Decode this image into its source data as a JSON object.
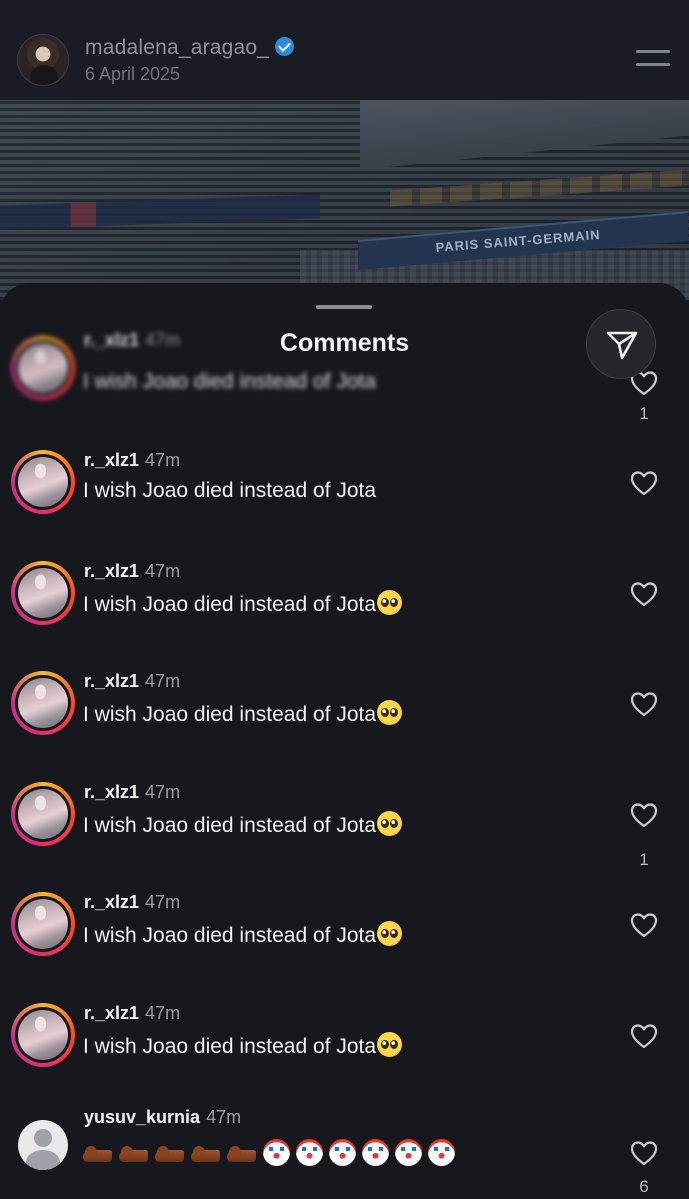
{
  "header": {
    "username": "madalena_aragao_",
    "date": "6 April 2025"
  },
  "photo": {
    "banner_text": "PARIS SAINT-GERMAIN"
  },
  "sheet": {
    "title": "Comments"
  },
  "comments": [
    {
      "user": "r._xlz1",
      "time": "47m",
      "text": "I wish Joao died instead of Jota",
      "likes": "1",
      "obscured": true
    },
    {
      "user": "r._xlz1",
      "time": "47m",
      "text": "I wish Joao died instead of Jota",
      "likes": ""
    },
    {
      "user": "r._xlz1",
      "time": "47m",
      "text": "I wish Joao died instead of Jota",
      "likes": "",
      "emoji": "pleading-face"
    },
    {
      "user": "r._xlz1",
      "time": "47m",
      "text": "I wish Joao died instead of Jota",
      "likes": "",
      "emoji": "pleading-face"
    },
    {
      "user": "r._xlz1",
      "time": "47m",
      "text": "I wish Joao died instead of Jota",
      "likes": "1",
      "emoji": "pleading-face"
    },
    {
      "user": "r._xlz1",
      "time": "47m",
      "text": "I wish Joao died instead of Jota",
      "likes": "",
      "emoji": "pleading-face"
    },
    {
      "user": "r._xlz1",
      "time": "47m",
      "text": "I wish Joao died instead of Jota",
      "likes": "",
      "emoji": "pleading-face"
    },
    {
      "user": "yusuv_kurnia",
      "time": "47m",
      "text": "",
      "likes": "6",
      "emoji_row": [
        "shoe",
        "shoe",
        "shoe",
        "shoe",
        "shoe",
        "clown",
        "clown",
        "clown",
        "clown",
        "clown",
        "clown"
      ]
    }
  ],
  "icons": {
    "verified": "verified-badge-icon",
    "menu": "menu-icon",
    "share": "paper-plane-icon",
    "like": "heart-icon"
  },
  "colors": {
    "verified": "#2d8bd9",
    "story_ring": "#e1306c"
  }
}
